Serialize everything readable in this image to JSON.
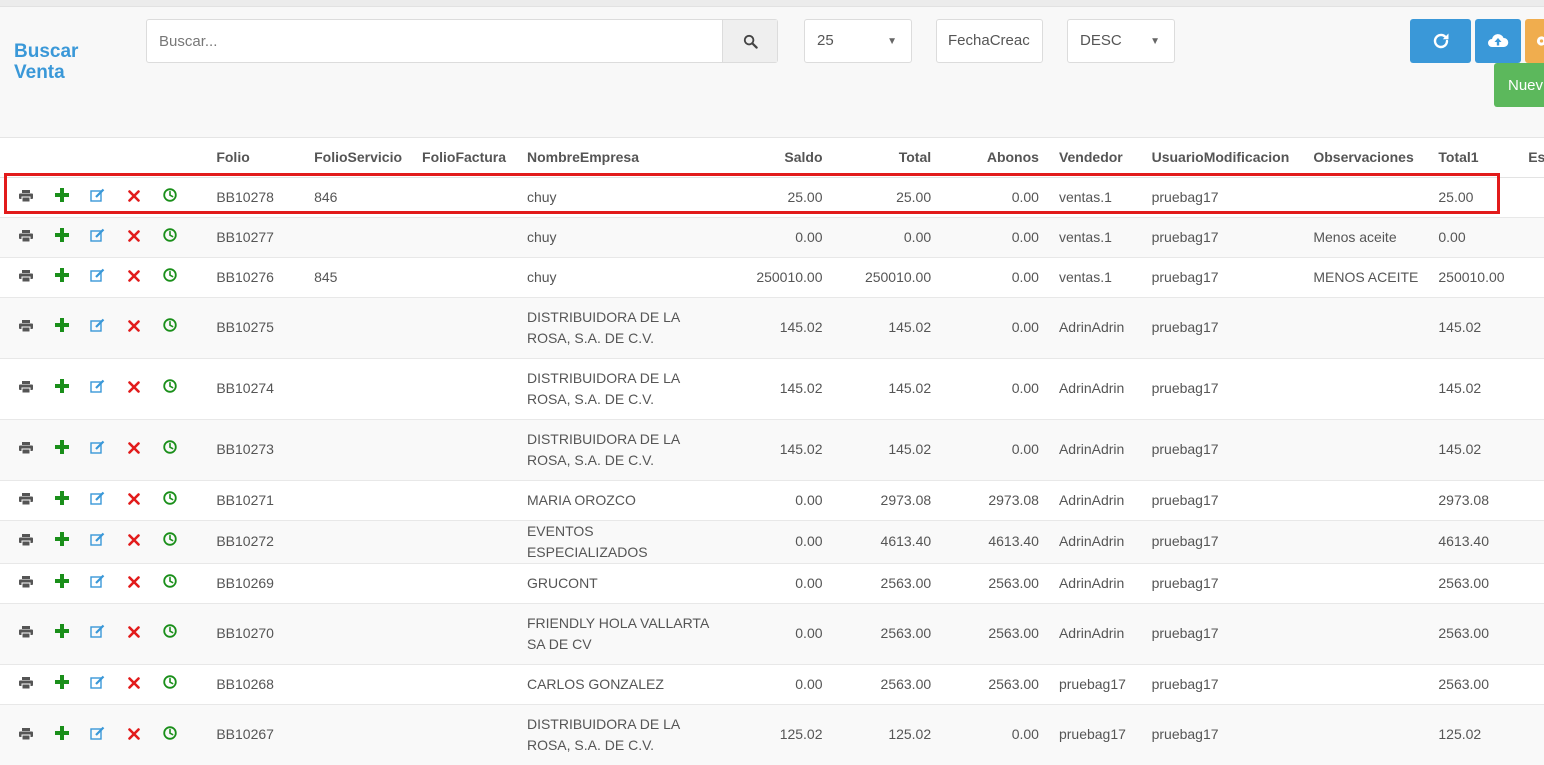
{
  "header": {
    "title": "Buscar Venta",
    "search_placeholder": "Buscar...",
    "page_size": "25",
    "sort_field": "FechaCreac",
    "sort_order": "DESC",
    "new_button_label": "Nuev"
  },
  "colors": {
    "accent_blue": "#3a98d8",
    "refresh_button": "#3a98d8",
    "upload_button": "#3a98d8",
    "orange_button": "#f0ad4e",
    "new_button": "#5cb85c",
    "highlight_border": "#e21b1b"
  },
  "table": {
    "columns": [
      "Folio",
      "FolioServicio",
      "FolioFactura",
      "NombreEmpresa",
      "Saldo",
      "Total",
      "Abonos",
      "Vendedor",
      "UsuarioModificacion",
      "Observaciones",
      "Total1",
      "Est"
    ],
    "rows": [
      [
        "BB10278",
        "846",
        "",
        "chuy",
        "25.00",
        "25.00",
        "0.00",
        "ventas.1",
        "pruebag17",
        "",
        "25.00"
      ],
      [
        "BB10277",
        "",
        "",
        "chuy",
        "0.00",
        "0.00",
        "0.00",
        "ventas.1",
        "pruebag17",
        "Menos aceite",
        "0.00"
      ],
      [
        "BB10276",
        "845",
        "",
        "chuy",
        "250010.00",
        "250010.00",
        "0.00",
        "ventas.1",
        "pruebag17",
        "MENOS ACEITE",
        "250010.00"
      ],
      [
        "BB10275",
        "",
        "",
        "DISTRIBUIDORA DE LA ROSA, S.A. DE C.V.",
        "145.02",
        "145.02",
        "0.00",
        "AdrinAdrin",
        "pruebag17",
        "",
        "145.02"
      ],
      [
        "BB10274",
        "",
        "",
        "DISTRIBUIDORA DE LA ROSA, S.A. DE C.V.",
        "145.02",
        "145.02",
        "0.00",
        "AdrinAdrin",
        "pruebag17",
        "",
        "145.02"
      ],
      [
        "BB10273",
        "",
        "",
        "DISTRIBUIDORA DE LA ROSA, S.A. DE C.V.",
        "145.02",
        "145.02",
        "0.00",
        "AdrinAdrin",
        "pruebag17",
        "",
        "145.02"
      ],
      [
        "BB10271",
        "",
        "",
        "MARIA OROZCO",
        "0.00",
        "2973.08",
        "2973.08",
        "AdrinAdrin",
        "pruebag17",
        "",
        "2973.08"
      ],
      [
        "BB10272",
        "",
        "",
        "EVENTOS ESPECIALIZADOS",
        "0.00",
        "4613.40",
        "4613.40",
        "AdrinAdrin",
        "pruebag17",
        "",
        "4613.40"
      ],
      [
        "BB10269",
        "",
        "",
        "GRUCONT",
        "0.00",
        "2563.00",
        "2563.00",
        "AdrinAdrin",
        "pruebag17",
        "",
        "2563.00"
      ],
      [
        "BB10270",
        "",
        "",
        "FRIENDLY HOLA VALLARTA SA DE CV",
        "0.00",
        "2563.00",
        "2563.00",
        "AdrinAdrin",
        "pruebag17",
        "",
        "2563.00"
      ],
      [
        "BB10268",
        "",
        "",
        "CARLOS GONZALEZ",
        "0.00",
        "2563.00",
        "2563.00",
        "pruebag17",
        "pruebag17",
        "",
        "2563.00"
      ],
      [
        "BB10267",
        "",
        "",
        "DISTRIBUIDORA DE LA ROSA, S.A. DE C.V.",
        "125.02",
        "125.02",
        "0.00",
        "pruebag17",
        "pruebag17",
        "",
        "125.02"
      ]
    ]
  }
}
